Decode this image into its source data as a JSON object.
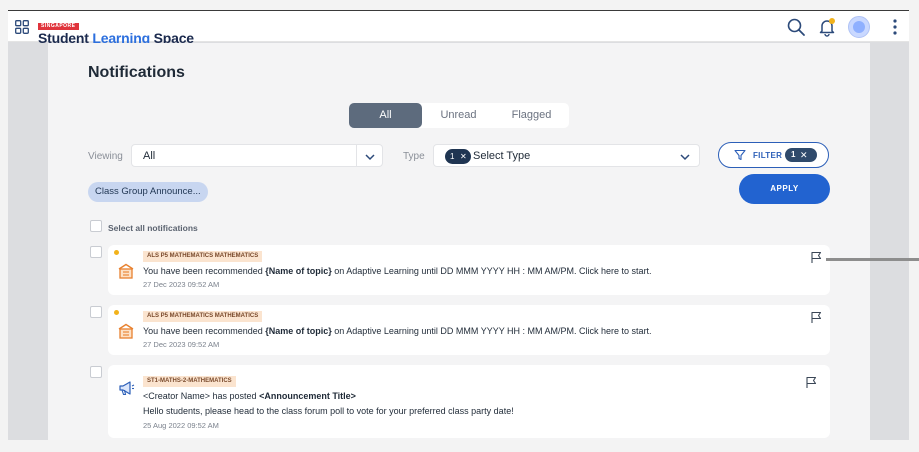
{
  "app": {
    "brand_tag": "SINGAPORE",
    "brand_part1": "Student ",
    "brand_part2": "Learning",
    "brand_part3": " Space"
  },
  "page": {
    "title": "Notifications"
  },
  "tabs": [
    {
      "label": "All",
      "active": true
    },
    {
      "label": "Unread",
      "active": false
    },
    {
      "label": "Flagged",
      "active": false
    }
  ],
  "filters": {
    "viewing_label": "Viewing",
    "viewing_value": "All",
    "type_label": "Type",
    "type_count": "1",
    "type_placeholder": "Select Type",
    "filter_label": "FILTER",
    "filter_count": "1",
    "apply_label": "APPLY",
    "active_chip": "Class Group Announce..."
  },
  "select_all_label": "Select all notifications",
  "notifications": [
    {
      "unread": true,
      "icon": "adaptive-learning-icon",
      "tag": "ALS P5 MATHEMATICS MATHEMATICS",
      "text_pre": "You have been recommended ",
      "text_bold": "{Name of topic}",
      "text_post": " on Adaptive Learning until DD MMM YYYY HH : MM AM/PM. Click here to start.",
      "timestamp": "27 Dec 2023 09:52 AM"
    },
    {
      "unread": true,
      "icon": "adaptive-learning-icon",
      "tag": "ALS P5 MATHEMATICS MATHEMATICS",
      "text_pre": "You have been recommended ",
      "text_bold": "{Name of topic}",
      "text_post": " on Adaptive Learning until DD MMM YYYY HH : MM AM/PM. Click here to start.",
      "timestamp": "27 Dec 2023 09:52 AM"
    },
    {
      "unread": false,
      "icon": "megaphone-icon",
      "tag": "ST1-MATHS-2-MATHEMATICS",
      "text_pre": "<Creator Name> has posted ",
      "text_bold": "<Announcement Title>",
      "text_post": "",
      "body": "Hello students, please head to the class forum poll to vote for your preferred class party date!",
      "timestamp": "25 Aug 2022 09:52 AM"
    }
  ],
  "colors": {
    "primary": "#2263d0",
    "tab_active": "#5d6b7d",
    "unread_dot": "#f2b21b",
    "tag_bg": "#fbe4cf"
  }
}
